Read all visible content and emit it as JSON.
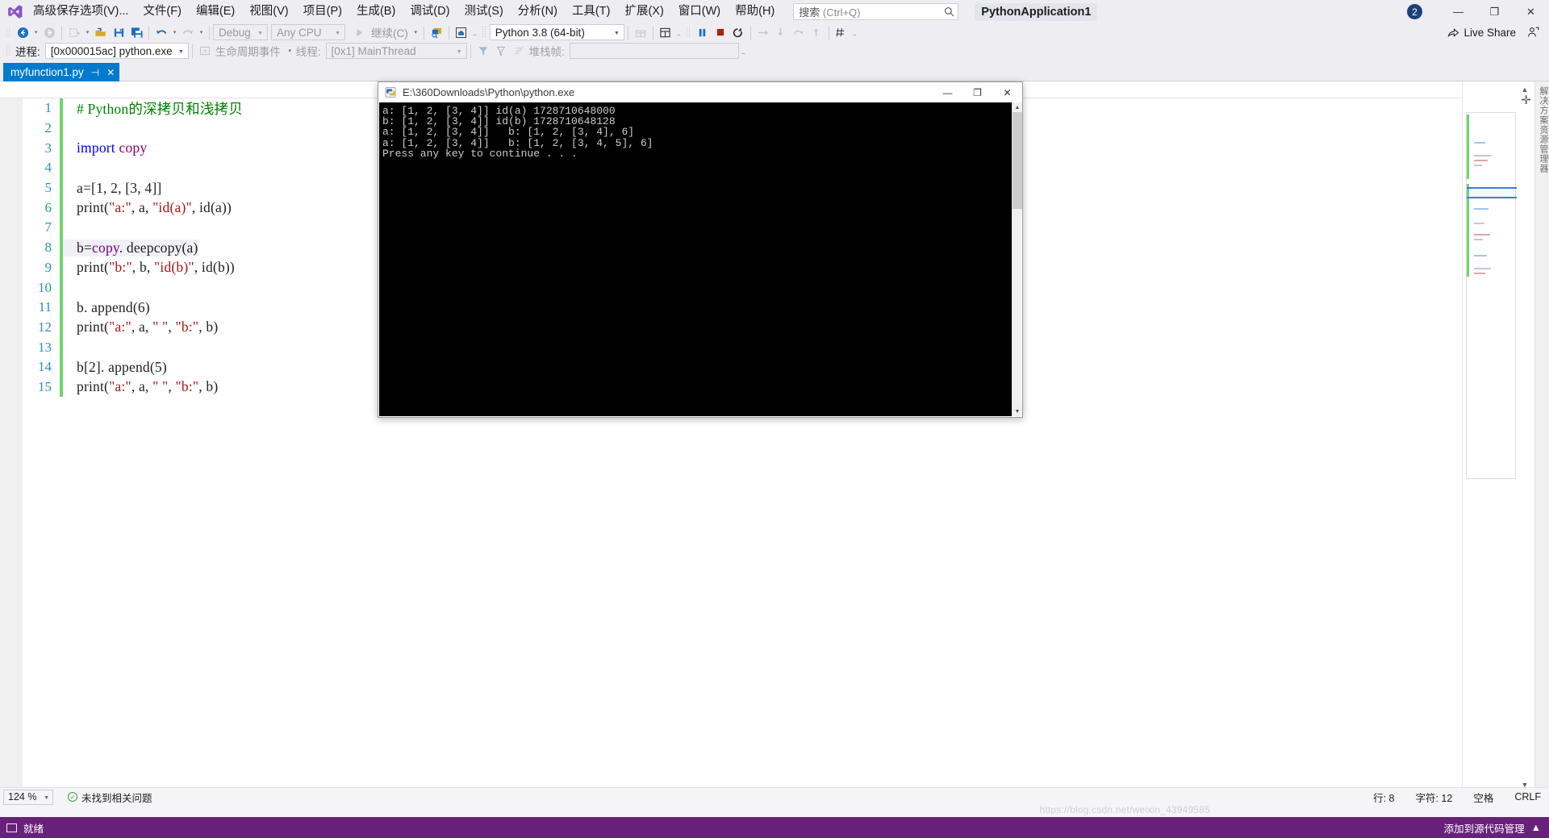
{
  "app": {
    "project_badge": "PythonApplication1",
    "notification_count": "2"
  },
  "menubar": {
    "logo_icon": "visual-studio-logo",
    "items": [
      {
        "label": "高级保存选项(V)..."
      },
      {
        "label": "文件(F)"
      },
      {
        "label": "编辑(E)"
      },
      {
        "label": "视图(V)"
      },
      {
        "label": "项目(P)"
      },
      {
        "label": "生成(B)"
      },
      {
        "label": "调试(D)"
      },
      {
        "label": "测试(S)"
      },
      {
        "label": "分析(N)"
      },
      {
        "label": "工具(T)"
      },
      {
        "label": "扩展(X)"
      },
      {
        "label": "窗口(W)"
      },
      {
        "label": "帮助(H)"
      }
    ],
    "search": {
      "label": "搜索",
      "hint": "(Ctrl+Q)",
      "icon": "search-icon"
    }
  },
  "window_controls": {
    "minimize": "—",
    "maximize": "❐",
    "close": "✕"
  },
  "liveshare": {
    "label": "Live Share",
    "icon": "live-share-icon",
    "feedback_icon": "feedback-icon"
  },
  "toolbar": {
    "back_icon": "navigate-back-icon",
    "forward_icon": "navigate-forward-icon",
    "new_project_icon": "new-project-icon",
    "open_file_icon": "open-file-icon",
    "save_icon": "save-icon",
    "save_all_icon": "save-all-icon",
    "undo_icon": "undo-icon",
    "redo_icon": "redo-icon",
    "config_combo": "Debug",
    "platform_combo": "Any CPU",
    "continue_label": "继续(C)",
    "continue_icon": "play-icon",
    "attach_icon": "attach-to-process-icon",
    "home_icon": "home-icon",
    "interpreter_combo": "Python 3.8 (64-bit)",
    "gift_icon": "gift-icon",
    "layout_icon": "window-layout-icon",
    "pause_icon": "pause-icon",
    "stop_icon": "stop-icon",
    "restart_icon": "restart-icon",
    "step_over_icon": "step-over-icon",
    "step_into_icon": "step-into-icon",
    "step_out_icon": "step-out-icon",
    "step_up_icon": "step-up-icon",
    "hot_reload_icon": "hot-reload-icon"
  },
  "debugbar": {
    "process_label": "进程:",
    "process_value": "[0x000015ac] python.exe",
    "lifecycle_label": "生命周期事件",
    "lifecycle_icon": "lifecycle-events-icon",
    "thread_label": "线程:",
    "thread_value": "[0x1] MainThread",
    "filter_icon": "filter-icon",
    "filter_clear_icon": "filter-clear-icon",
    "no_filter_icon": "no-filter-icon",
    "stackframe_label": "堆栈帧:",
    "stackframe_value": ""
  },
  "tab": {
    "filename": "myfunction1.py",
    "pin_icon": "pin-icon",
    "close_icon": "close-icon"
  },
  "editor": {
    "lines": [
      {
        "n": "1",
        "changed": true,
        "current": false,
        "tokens": [
          {
            "t": "# Python的深拷贝和浅拷贝",
            "c": "cmt"
          }
        ]
      },
      {
        "n": "2",
        "changed": true,
        "current": false,
        "tokens": []
      },
      {
        "n": "3",
        "changed": true,
        "current": false,
        "tokens": [
          {
            "t": "import",
            "c": "kw"
          },
          {
            "t": " ",
            "c": "pln"
          },
          {
            "t": "copy",
            "c": "mod"
          }
        ]
      },
      {
        "n": "4",
        "changed": true,
        "current": false,
        "tokens": []
      },
      {
        "n": "5",
        "changed": true,
        "current": false,
        "tokens": [
          {
            "t": "a=[1, 2, [3, 4]]",
            "c": "pln"
          }
        ]
      },
      {
        "n": "6",
        "changed": true,
        "current": false,
        "tokens": [
          {
            "t": "print(",
            "c": "pln"
          },
          {
            "t": "\"a:\"",
            "c": "str"
          },
          {
            "t": ", a, ",
            "c": "pln"
          },
          {
            "t": "\"id(a)\"",
            "c": "str"
          },
          {
            "t": ", id(a))",
            "c": "pln"
          }
        ]
      },
      {
        "n": "7",
        "changed": true,
        "current": false,
        "tokens": []
      },
      {
        "n": "8",
        "changed": true,
        "current": true,
        "tokens": [
          {
            "t": "b=",
            "c": "pln"
          },
          {
            "t": "copy",
            "c": "mod"
          },
          {
            "t": ". deepcopy(a)",
            "c": "pln"
          }
        ]
      },
      {
        "n": "9",
        "changed": true,
        "current": false,
        "tokens": [
          {
            "t": "print(",
            "c": "pln"
          },
          {
            "t": "\"b:\"",
            "c": "str"
          },
          {
            "t": ", b, ",
            "c": "pln"
          },
          {
            "t": "\"id(b)\"",
            "c": "str"
          },
          {
            "t": ", id(b))",
            "c": "pln"
          }
        ]
      },
      {
        "n": "10",
        "changed": true,
        "current": false,
        "tokens": []
      },
      {
        "n": "11",
        "changed": true,
        "current": false,
        "tokens": [
          {
            "t": "b. append(6)",
            "c": "pln"
          }
        ]
      },
      {
        "n": "12",
        "changed": true,
        "current": false,
        "tokens": [
          {
            "t": "print(",
            "c": "pln"
          },
          {
            "t": "\"a:\"",
            "c": "str"
          },
          {
            "t": ", a, ",
            "c": "pln"
          },
          {
            "t": "\" \"",
            "c": "str"
          },
          {
            "t": ", ",
            "c": "pln"
          },
          {
            "t": "\"b:\"",
            "c": "str"
          },
          {
            "t": ", b)",
            "c": "pln"
          }
        ]
      },
      {
        "n": "13",
        "changed": true,
        "current": false,
        "tokens": []
      },
      {
        "n": "14",
        "changed": true,
        "current": false,
        "tokens": [
          {
            "t": "b[2]. append(5)",
            "c": "pln"
          }
        ]
      },
      {
        "n": "15",
        "changed": true,
        "current": false,
        "tokens": [
          {
            "t": "print(",
            "c": "pln"
          },
          {
            "t": "\"a:\"",
            "c": "str"
          },
          {
            "t": ", a, ",
            "c": "pln"
          },
          {
            "t": "\" \"",
            "c": "str"
          },
          {
            "t": ", ",
            "c": "pln"
          },
          {
            "t": "\"b:\"",
            "c": "str"
          },
          {
            "t": ", b)",
            "c": "pln"
          }
        ]
      }
    ]
  },
  "minimap": {
    "vertical_label": "解决方案资源管理器",
    "add_icon": "add-icon",
    "scroll_up_icon": "scroll-up-icon",
    "scroll_down_icon": "scroll-down-icon"
  },
  "console": {
    "title": "E:\\360Downloads\\Python\\python.exe",
    "icon": "python-console-icon",
    "minimize": "—",
    "maximize": "❐",
    "close": "✕",
    "output": [
      "a: [1, 2, [3, 4]] id(a) 1728710648000",
      "b: [1, 2, [3, 4]] id(b) 1728710648128",
      "a: [1, 2, [3, 4]]   b: [1, 2, [3, 4], 6]",
      "a: [1, 2, [3, 4]]   b: [1, 2, [3, 4, 5], 6]",
      "Press any key to continue . . ."
    ],
    "scroll_up_icon": "scroll-up-icon",
    "scroll_down_icon": "scroll-down-icon"
  },
  "editor_status": {
    "zoom": "124 %",
    "issues": "未找到相关问题",
    "check_icon": "check-icon",
    "line_label": "行: 8",
    "col_label": "字符: 12",
    "space_label": "空格",
    "eol_label": "CRLF"
  },
  "statusbar": {
    "state": "就绪",
    "flag_icon": "status-flag-icon",
    "source_control": "添加到源代码管理",
    "source_control_caret": "▲"
  },
  "watermark": "https://blog.csdn.net/weixin_43949585",
  "colors": {
    "accent": "#68217a",
    "tab_active": "#007acc",
    "linenum": "#2b91af",
    "comment": "#008000",
    "keyword": "#0000ff",
    "string": "#a31515",
    "module": "#800080",
    "changebar": "#6fd66f"
  }
}
